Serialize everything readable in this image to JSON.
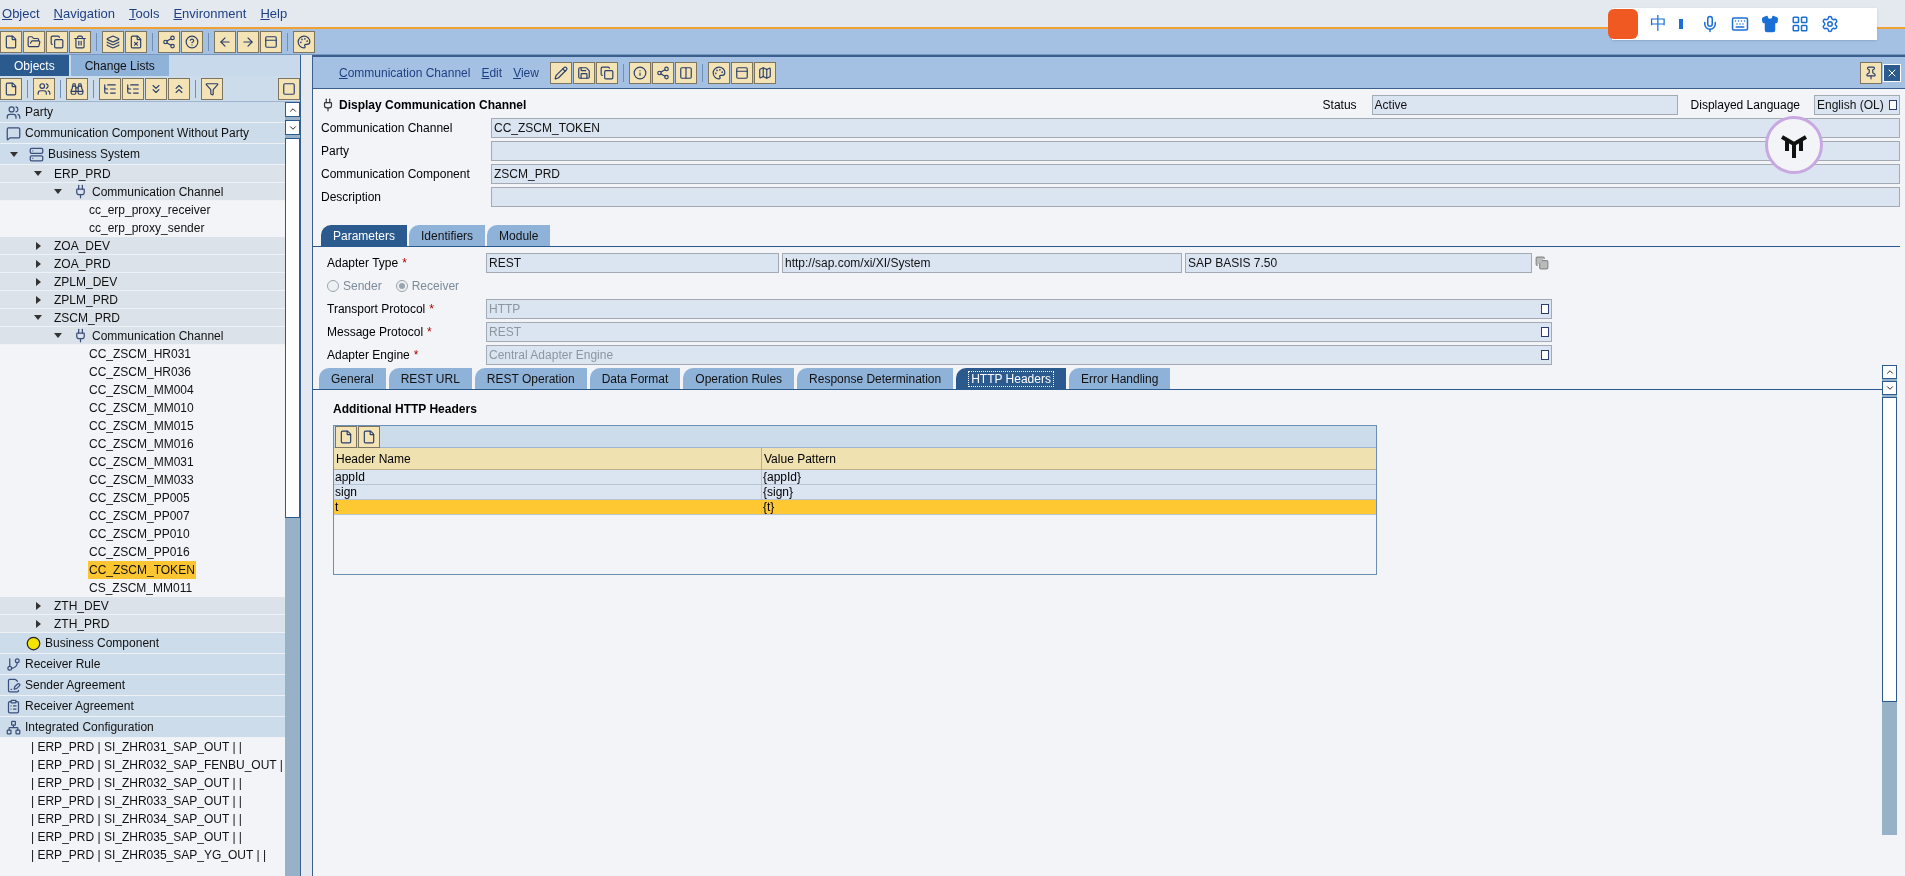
{
  "menubar": [
    "Object",
    "Navigation",
    "Tools",
    "Environment",
    "Help"
  ],
  "ime_bar": {
    "mode": "中"
  },
  "left_tabs": [
    {
      "label": "Objects",
      "selected": true
    },
    {
      "label": "Change Lists",
      "selected": false
    }
  ],
  "tree": [
    {
      "label": "Party",
      "kind": "party"
    },
    {
      "label": "Communication Component Without Party",
      "kind": "standalone"
    },
    {
      "label": "Business System",
      "kind": "system",
      "expanded": true,
      "children": [
        {
          "label": "ERP_PRD",
          "expanded": true,
          "children": [
            {
              "label": "Communication Channel",
              "kind": "channel",
              "expanded": true,
              "children": [
                {
                  "label": "cc_erp_proxy_receiver",
                  "selected": false
                },
                {
                  "label": "cc_erp_proxy_sender",
                  "selected": false
                }
              ]
            }
          ]
        },
        {
          "label": "ZOA_DEV",
          "expanded": false
        },
        {
          "label": "ZOA_PRD",
          "expanded": false
        },
        {
          "label": "ZPLM_DEV",
          "expanded": false
        },
        {
          "label": "ZPLM_PRD",
          "expanded": false
        },
        {
          "label": "ZSCM_PRD",
          "expanded": true,
          "children": [
            {
              "label": "Communication Channel",
              "kind": "channel",
              "expanded": true,
              "children": [
                {
                  "label": "CC_ZSCM_HR031",
                  "selected": false
                },
                {
                  "label": "CC_ZSCM_HR036",
                  "selected": false
                },
                {
                  "label": "CC_ZSCM_MM004",
                  "selected": false
                },
                {
                  "label": "CC_ZSCM_MM010",
                  "selected": false
                },
                {
                  "label": "CC_ZSCM_MM015",
                  "selected": false
                },
                {
                  "label": "CC_ZSCM_MM016",
                  "selected": false
                },
                {
                  "label": "CC_ZSCM_MM031",
                  "selected": false
                },
                {
                  "label": "CC_ZSCM_MM033",
                  "selected": false
                },
                {
                  "label": "CC_ZSCM_PP005",
                  "selected": false
                },
                {
                  "label": "CC_ZSCM_PP007",
                  "selected": false
                },
                {
                  "label": "CC_ZSCM_PP010",
                  "selected": false
                },
                {
                  "label": "CC_ZSCM_PP016",
                  "selected": false
                },
                {
                  "label": "CC_ZSCM_TOKEN",
                  "selected": true
                },
                {
                  "label": "CS_ZSCM_MM011",
                  "selected": false
                }
              ]
            }
          ]
        },
        {
          "label": "ZTH_DEV",
          "expanded": false
        },
        {
          "label": "ZTH_PRD",
          "expanded": false
        }
      ]
    },
    {
      "label": "Business Component",
      "kind": "business"
    },
    {
      "label": "Receiver Rule",
      "kind": "rule"
    },
    {
      "label": "Sender Agreement",
      "kind": "sender"
    },
    {
      "label": "Receiver Agreement",
      "kind": "receiver"
    },
    {
      "label": "Integrated Configuration",
      "kind": "integrated",
      "children": [
        {
          "label": "| ERP_PRD | SI_ZHR031_SAP_OUT |  |",
          "selected": false
        },
        {
          "label": "| ERP_PRD | SI_ZHR032_SAP_FENBU_OUT |",
          "selected": false
        },
        {
          "label": "| ERP_PRD | SI_ZHR032_SAP_OUT |  |",
          "selected": false
        },
        {
          "label": "| ERP_PRD | SI_ZHR033_SAP_OUT |  |",
          "selected": false
        },
        {
          "label": "| ERP_PRD | SI_ZHR034_SAP_OUT |  |",
          "selected": false
        },
        {
          "label": "| ERP_PRD | SI_ZHR035_SAP_OUT |  |",
          "selected": false
        },
        {
          "label": "| ERP_PRD | SI_ZHR035_SAP_YG_OUT |  |",
          "selected": false
        }
      ]
    }
  ],
  "editor_menu": [
    "Communication Channel",
    "Edit",
    "View"
  ],
  "title": "Display Communication Channel",
  "status": {
    "label": "Status",
    "value": "Active"
  },
  "language": {
    "label": "Displayed Language",
    "value": "English (OL)"
  },
  "header_fields": [
    {
      "label": "Communication Channel",
      "value": "CC_ZSCM_TOKEN"
    },
    {
      "label": "Party"
    },
    {
      "label": "Communication Component",
      "value": "ZSCM_PRD"
    },
    {
      "label": "Description"
    }
  ],
  "tabs": [
    {
      "label": "Parameters",
      "selected": true
    },
    {
      "label": "Identifiers",
      "selected": false
    },
    {
      "label": "Module",
      "selected": false
    }
  ],
  "adapter_type": {
    "label": "Adapter Type",
    "required_mark": "*",
    "values": [
      "REST",
      "http://sap.com/xi/XI/System",
      "SAP BASIS 7.50"
    ]
  },
  "direction": [
    {
      "label": "Sender",
      "selected": false
    },
    {
      "label": "Receiver",
      "selected": true
    }
  ],
  "protocol_fields": [
    {
      "label": "Transport Protocol",
      "required_mark": "*",
      "value": "HTTP",
      "disabled": true
    },
    {
      "label": "Message Protocol",
      "required_mark": "*",
      "value": "REST",
      "disabled": true
    },
    {
      "label": "Adapter Engine",
      "required_mark": "*",
      "value": "Central Adapter Engine",
      "disabled": true
    }
  ],
  "sub_tabs": [
    {
      "label": "General",
      "selected": false
    },
    {
      "label": "REST URL",
      "selected": false
    },
    {
      "label": "REST Operation",
      "selected": false
    },
    {
      "label": "Data Format",
      "selected": false
    },
    {
      "label": "Operation Rules",
      "selected": false
    },
    {
      "label": "Response Determination",
      "selected": false
    },
    {
      "label": "HTTP Headers",
      "selected": true
    },
    {
      "label": "Error Handling",
      "selected": false
    }
  ],
  "headers_table": {
    "title": "Additional HTTP Headers",
    "columns": [
      "Header Name",
      "Value Pattern"
    ],
    "rows": [
      {
        "cells": [
          "appId",
          "{appId}"
        ],
        "selected": false
      },
      {
        "cells": [
          "sign",
          "{sign}"
        ],
        "selected": false
      },
      {
        "cells": [
          "t",
          "{t}"
        ],
        "selected": true
      }
    ]
  }
}
